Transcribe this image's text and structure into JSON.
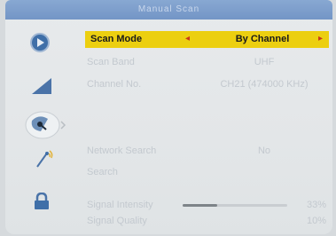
{
  "header": {
    "title": "Manual Scan"
  },
  "sidebar": {
    "items": [
      {
        "name": "play",
        "icon": "play-circle-icon"
      },
      {
        "name": "signal",
        "icon": "signal-wedge-icon"
      },
      {
        "name": "satellite",
        "icon": "satellite-dish-icon"
      },
      {
        "name": "antenna",
        "icon": "antenna-icon"
      },
      {
        "name": "lock",
        "icon": "lock-icon"
      }
    ]
  },
  "menu": {
    "scan_mode": {
      "label": "Scan Mode",
      "value": "By Channel",
      "left_arrow": "◂",
      "right_arrow": "▸"
    },
    "scan_band": {
      "label": "Scan Band",
      "value": "UHF"
    },
    "channel_no": {
      "label": "Channel No.",
      "value": "CH21 (474000 KHz)"
    },
    "network_search": {
      "label": "Network Search",
      "value": "No"
    },
    "search": {
      "label": "Search"
    }
  },
  "signal": {
    "intensity": {
      "label": "Signal Intensity",
      "value": "33%",
      "level": 0.33
    },
    "quality": {
      "label": "Signal Quality",
      "value": "10%",
      "level": 0.1
    }
  },
  "colors": {
    "highlight": "#eccf10",
    "arrow": "#c93a1a",
    "icon_blue": "#3f6fa8"
  }
}
